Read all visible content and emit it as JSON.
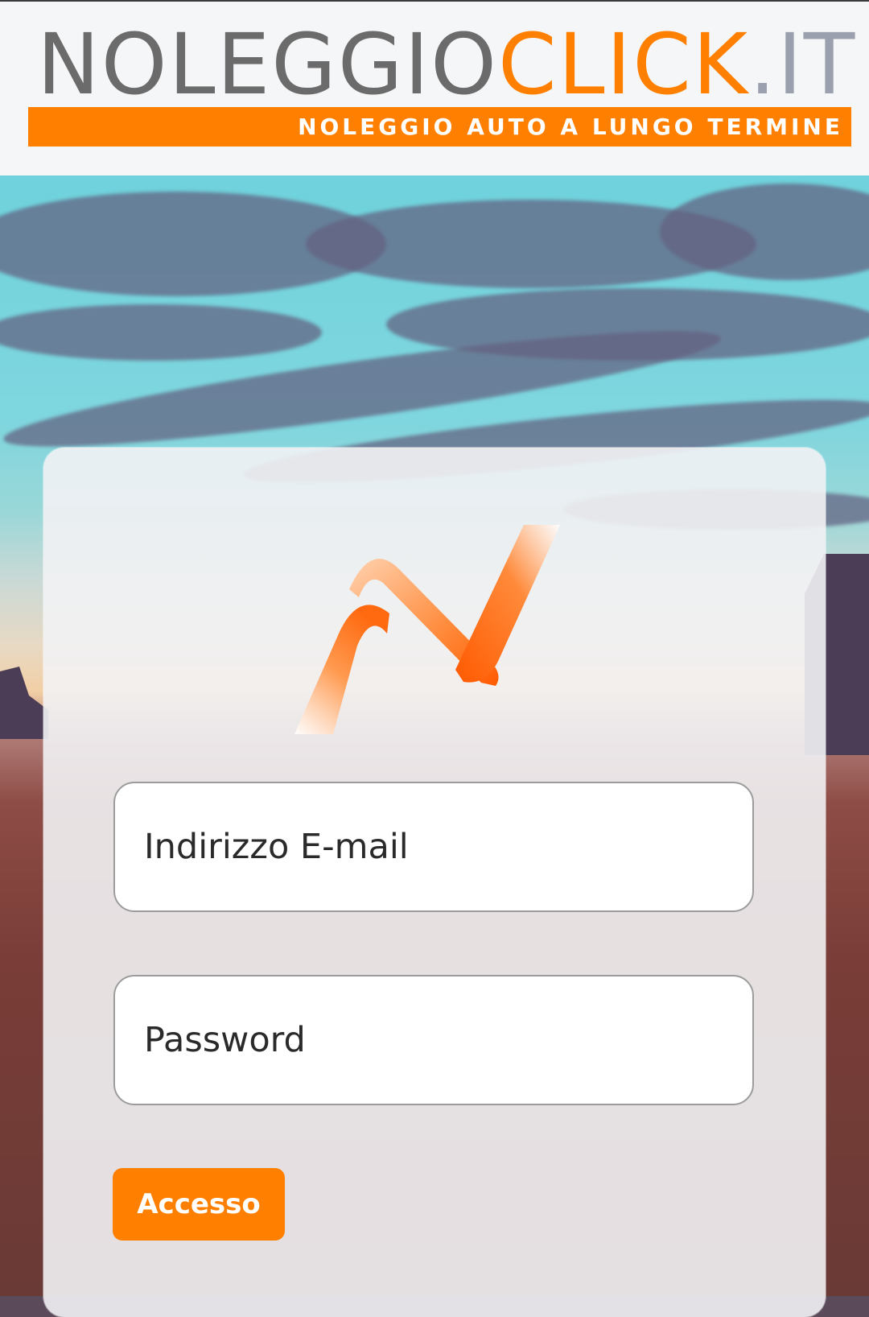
{
  "brand": {
    "wordmark_part1": "NOLEGGIO",
    "wordmark_part2": "CLICK",
    "wordmark_part3": ".IT",
    "tagline": "NOLEGGIO AUTO A LUNGO TERMINE",
    "colors": {
      "orange": "#ff8000",
      "gray": "#6b6b6b",
      "light_gray": "#9aa0ad"
    }
  },
  "login": {
    "email_placeholder": "Indirizzo E-mail",
    "password_placeholder": "Password",
    "submit_label": "Accesso"
  },
  "icons": {
    "card_logo": "orange-n-ribbon-logo"
  }
}
